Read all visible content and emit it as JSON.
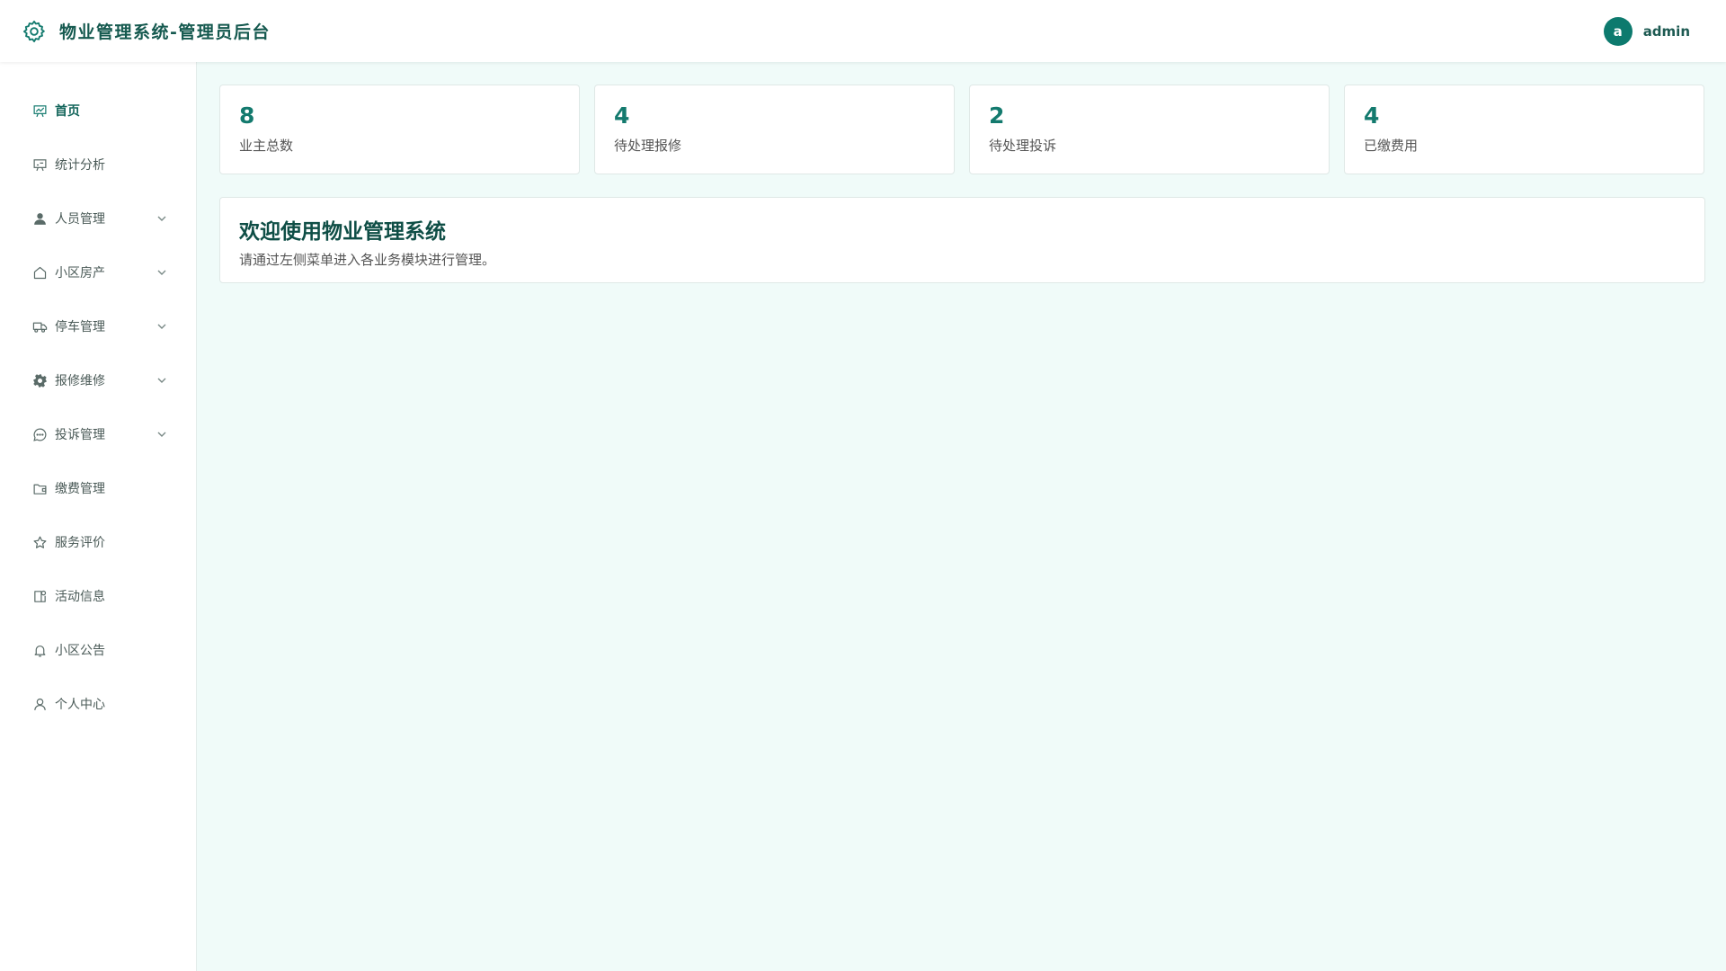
{
  "header": {
    "title": "物业管理系统-管理员后台",
    "brand_icon": "gear-icon",
    "user": {
      "avatar_letter": "a",
      "name": "admin"
    }
  },
  "sidebar": {
    "items": [
      {
        "label": "首页",
        "icon": "chart-board-icon",
        "active": true,
        "has_submenu": false
      },
      {
        "label": "统计分析",
        "icon": "chart-board-icon",
        "active": false,
        "has_submenu": false
      },
      {
        "label": "人员管理",
        "icon": "user-icon",
        "active": false,
        "has_submenu": true
      },
      {
        "label": "小区房产",
        "icon": "house-icon",
        "active": false,
        "has_submenu": true
      },
      {
        "label": "停车管理",
        "icon": "truck-icon",
        "active": false,
        "has_submenu": true
      },
      {
        "label": "报修维修",
        "icon": "gear-icon",
        "active": false,
        "has_submenu": true
      },
      {
        "label": "投诉管理",
        "icon": "chat-icon",
        "active": false,
        "has_submenu": true
      },
      {
        "label": "缴费管理",
        "icon": "wallet-icon",
        "active": false,
        "has_submenu": false
      },
      {
        "label": "服务评价",
        "icon": "star-icon",
        "active": false,
        "has_submenu": false
      },
      {
        "label": "活动信息",
        "icon": "notebook-icon",
        "active": false,
        "has_submenu": false
      },
      {
        "label": "小区公告",
        "icon": "bell-icon",
        "active": false,
        "has_submenu": false
      },
      {
        "label": "个人中心",
        "icon": "person-outline-icon",
        "active": false,
        "has_submenu": false
      }
    ]
  },
  "stats": [
    {
      "value": "8",
      "label": "业主总数"
    },
    {
      "value": "4",
      "label": "待处理报修"
    },
    {
      "value": "2",
      "label": "待处理投诉"
    },
    {
      "value": "4",
      "label": "已缴费用"
    }
  ],
  "welcome": {
    "title": "欢迎使用物业管理系统",
    "description": "请通过左侧菜单进入各业务模块进行管理。"
  },
  "colors": {
    "accent": "#137a6e",
    "page_bg": "#f0fbf9",
    "title_dark": "#15594f"
  }
}
